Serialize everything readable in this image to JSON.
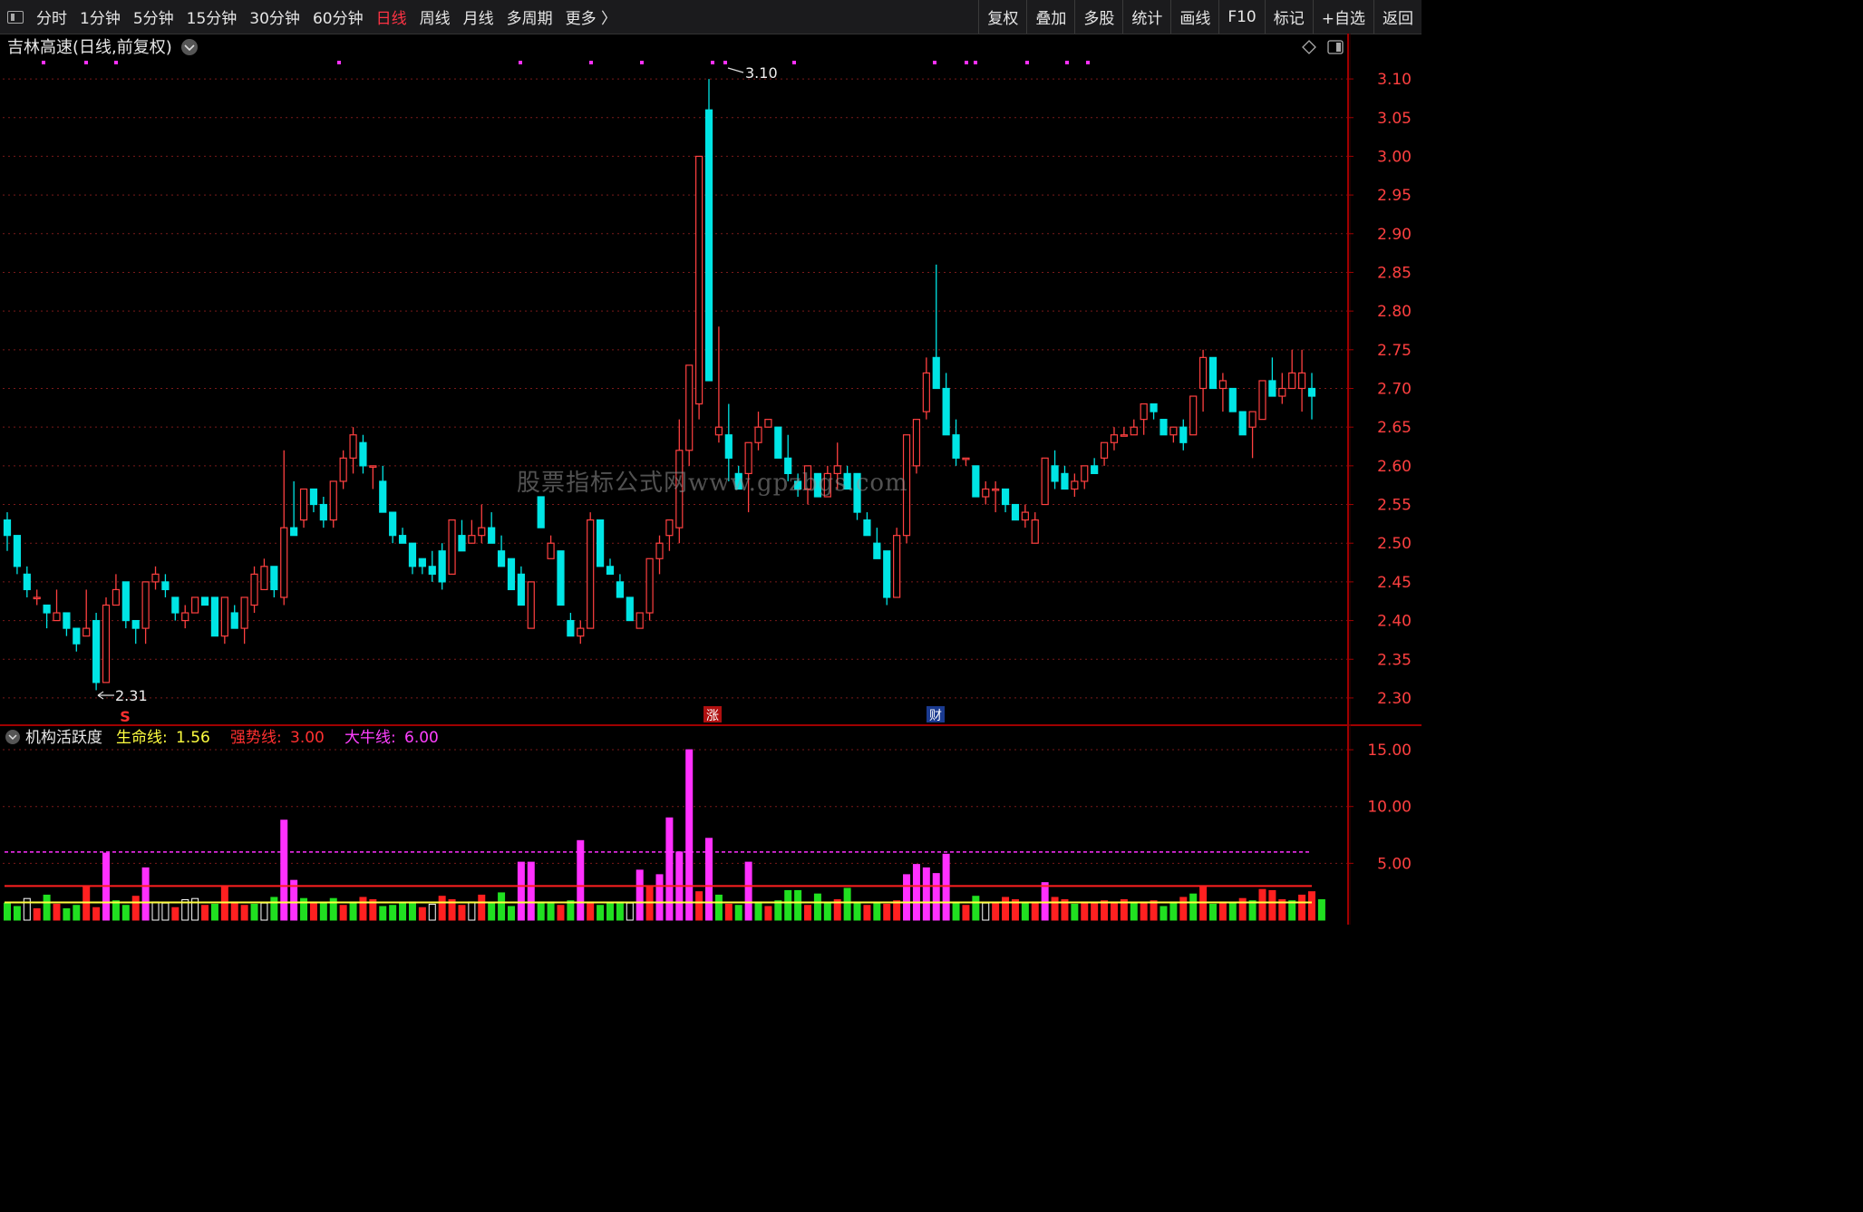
{
  "toolbar": {
    "periods": [
      "分时",
      "1分钟",
      "5分钟",
      "15分钟",
      "30分钟",
      "60分钟",
      "日线",
      "周线",
      "月线",
      "多周期",
      "更多 〉"
    ],
    "active_period": "日线",
    "right_buttons": [
      "复权",
      "叠加",
      "多股",
      "统计",
      "画线",
      "F10",
      "标记",
      "+自选",
      "返回"
    ]
  },
  "main_chart": {
    "title": "吉林高速(日线,前复权)",
    "high_label": "3.10",
    "low_label": "2.31",
    "y_ticks": [
      "3.10",
      "3.05",
      "3.00",
      "2.95",
      "2.90",
      "2.85",
      "2.80",
      "2.75",
      "2.70",
      "2.65",
      "2.60",
      "2.55",
      "2.50",
      "2.45",
      "2.40",
      "2.35",
      "2.30"
    ],
    "markers": {
      "s": "S",
      "zhang": "涨",
      "cai": "财"
    }
  },
  "indicator": {
    "name": "机构活跃度",
    "lines": [
      {
        "label": "生命线:",
        "value": "1.56",
        "color": "#ffff40"
      },
      {
        "label": "强势线:",
        "value": "3.00",
        "color": "#ff3030"
      },
      {
        "label": "大牛线:",
        "value": "6.00",
        "color": "#ff40ff"
      }
    ],
    "y_ticks": [
      "15.00",
      "10.00",
      "5.00"
    ]
  },
  "watermark": "股票指标公式网www.gpzbgs.com",
  "colors": {
    "up": "#ff4040",
    "down": "#00e5e5",
    "grid": "#7a1a1a",
    "axis": "#a00000",
    "magenta": "#ff30ff",
    "green": "#20e020"
  },
  "chart_data": {
    "type": "candlestick",
    "price_ylim": [
      2.28,
      3.12
    ],
    "indicator_ylim": [
      0,
      17
    ],
    "candles": [
      [
        2.53,
        2.54,
        2.49,
        2.51
      ],
      [
        2.51,
        2.51,
        2.46,
        2.47
      ],
      [
        2.46,
        2.47,
        2.43,
        2.44
      ],
      [
        2.43,
        2.44,
        2.42,
        2.43
      ],
      [
        2.42,
        2.42,
        2.39,
        2.41
      ],
      [
        2.4,
        2.44,
        2.4,
        2.41
      ],
      [
        2.41,
        2.41,
        2.38,
        2.39
      ],
      [
        2.39,
        2.39,
        2.36,
        2.37
      ],
      [
        2.38,
        2.44,
        2.38,
        2.39
      ],
      [
        2.4,
        2.41,
        2.31,
        2.32
      ],
      [
        2.32,
        2.43,
        2.32,
        2.42
      ],
      [
        2.42,
        2.46,
        2.42,
        2.44
      ],
      [
        2.45,
        2.45,
        2.39,
        2.4
      ],
      [
        2.4,
        2.4,
        2.37,
        2.39
      ],
      [
        2.39,
        2.45,
        2.37,
        2.45
      ],
      [
        2.45,
        2.47,
        2.44,
        2.46
      ],
      [
        2.45,
        2.46,
        2.43,
        2.44
      ],
      [
        2.43,
        2.43,
        2.4,
        2.41
      ],
      [
        2.4,
        2.42,
        2.39,
        2.41
      ],
      [
        2.41,
        2.43,
        2.41,
        2.43
      ],
      [
        2.43,
        2.43,
        2.42,
        2.42
      ],
      [
        2.43,
        2.43,
        2.38,
        2.38
      ],
      [
        2.38,
        2.43,
        2.37,
        2.43
      ],
      [
        2.41,
        2.42,
        2.39,
        2.39
      ],
      [
        2.39,
        2.43,
        2.37,
        2.43
      ],
      [
        2.42,
        2.47,
        2.41,
        2.46
      ],
      [
        2.44,
        2.48,
        2.44,
        2.47
      ],
      [
        2.47,
        2.47,
        2.43,
        2.44
      ],
      [
        2.43,
        2.62,
        2.42,
        2.52
      ],
      [
        2.52,
        2.58,
        2.52,
        2.51
      ],
      [
        2.53,
        2.57,
        2.52,
        2.57
      ],
      [
        2.57,
        2.57,
        2.54,
        2.55
      ],
      [
        2.55,
        2.56,
        2.52,
        2.53
      ],
      [
        2.53,
        2.58,
        2.52,
        2.58
      ],
      [
        2.58,
        2.62,
        2.57,
        2.61
      ],
      [
        2.61,
        2.65,
        2.59,
        2.64
      ],
      [
        2.63,
        2.64,
        2.59,
        2.6
      ],
      [
        2.6,
        2.6,
        2.57,
        2.6
      ],
      [
        2.58,
        2.6,
        2.54,
        2.54
      ],
      [
        2.54,
        2.54,
        2.5,
        2.51
      ],
      [
        2.51,
        2.52,
        2.5,
        2.5
      ],
      [
        2.5,
        2.5,
        2.46,
        2.47
      ],
      [
        2.48,
        2.48,
        2.46,
        2.47
      ],
      [
        2.47,
        2.49,
        2.45,
        2.46
      ],
      [
        2.49,
        2.5,
        2.44,
        2.45
      ],
      [
        2.46,
        2.53,
        2.46,
        2.53
      ],
      [
        2.51,
        2.53,
        2.49,
        2.49
      ],
      [
        2.5,
        2.53,
        2.5,
        2.51
      ],
      [
        2.51,
        2.55,
        2.5,
        2.52
      ],
      [
        2.52,
        2.54,
        2.5,
        2.5
      ],
      [
        2.49,
        2.51,
        2.48,
        2.47
      ],
      [
        2.48,
        2.48,
        2.44,
        2.44
      ],
      [
        2.46,
        2.47,
        2.42,
        2.42
      ],
      [
        2.39,
        2.45,
        2.39,
        2.45
      ],
      [
        2.56,
        2.56,
        2.52,
        2.52
      ],
      [
        2.48,
        2.51,
        2.48,
        2.5
      ],
      [
        2.49,
        2.49,
        2.42,
        2.42
      ],
      [
        2.4,
        2.41,
        2.38,
        2.38
      ],
      [
        2.38,
        2.4,
        2.37,
        2.39
      ],
      [
        2.39,
        2.54,
        2.39,
        2.53
      ],
      [
        2.53,
        2.53,
        2.47,
        2.47
      ],
      [
        2.47,
        2.48,
        2.46,
        2.46
      ],
      [
        2.45,
        2.46,
        2.43,
        2.43
      ],
      [
        2.43,
        2.43,
        2.4,
        2.4
      ],
      [
        2.39,
        2.4,
        2.39,
        2.41
      ],
      [
        2.41,
        2.48,
        2.4,
        2.48
      ],
      [
        2.48,
        2.51,
        2.46,
        2.5
      ],
      [
        2.51,
        2.53,
        2.49,
        2.53
      ],
      [
        2.52,
        2.66,
        2.5,
        2.62
      ],
      [
        2.62,
        2.7,
        2.6,
        2.73
      ],
      [
        2.68,
        3.0,
        2.66,
        3.0
      ],
      [
        3.06,
        3.1,
        2.74,
        2.71
      ],
      [
        2.64,
        2.78,
        2.63,
        2.65
      ],
      [
        2.64,
        2.68,
        2.58,
        2.61
      ],
      [
        2.59,
        2.6,
        2.57,
        2.57
      ],
      [
        2.59,
        2.63,
        2.54,
        2.63
      ],
      [
        2.63,
        2.67,
        2.62,
        2.65
      ],
      [
        2.65,
        2.66,
        2.65,
        2.66
      ],
      [
        2.65,
        2.65,
        2.61,
        2.61
      ],
      [
        2.61,
        2.64,
        2.58,
        2.59
      ],
      [
        2.58,
        2.59,
        2.56,
        2.57
      ],
      [
        2.57,
        2.6,
        2.55,
        2.6
      ],
      [
        2.59,
        2.59,
        2.56,
        2.56
      ],
      [
        2.56,
        2.6,
        2.56,
        2.59
      ],
      [
        2.59,
        2.63,
        2.57,
        2.6
      ],
      [
        2.59,
        2.6,
        2.57,
        2.57
      ],
      [
        2.59,
        2.59,
        2.53,
        2.54
      ],
      [
        2.53,
        2.54,
        2.51,
        2.51
      ],
      [
        2.5,
        2.52,
        2.48,
        2.48
      ],
      [
        2.49,
        2.49,
        2.42,
        2.43
      ],
      [
        2.43,
        2.52,
        2.43,
        2.51
      ],
      [
        2.51,
        2.64,
        2.5,
        2.64
      ],
      [
        2.6,
        2.66,
        2.59,
        2.66
      ],
      [
        2.67,
        2.74,
        2.66,
        2.72
      ],
      [
        2.74,
        2.86,
        2.7,
        2.7
      ],
      [
        2.7,
        2.72,
        2.64,
        2.64
      ],
      [
        2.64,
        2.66,
        2.6,
        2.61
      ],
      [
        2.61,
        2.61,
        2.6,
        2.61
      ],
      [
        2.6,
        2.6,
        2.56,
        2.56
      ],
      [
        2.56,
        2.58,
        2.55,
        2.57
      ],
      [
        2.57,
        2.58,
        2.54,
        2.57
      ],
      [
        2.57,
        2.57,
        2.54,
        2.55
      ],
      [
        2.55,
        2.55,
        2.53,
        2.53
      ],
      [
        2.53,
        2.55,
        2.52,
        2.54
      ],
      [
        2.5,
        2.54,
        2.5,
        2.53
      ],
      [
        2.55,
        2.61,
        2.55,
        2.61
      ],
      [
        2.6,
        2.62,
        2.57,
        2.58
      ],
      [
        2.59,
        2.6,
        2.57,
        2.57
      ],
      [
        2.57,
        2.59,
        2.56,
        2.58
      ],
      [
        2.58,
        2.6,
        2.57,
        2.6
      ],
      [
        2.6,
        2.61,
        2.59,
        2.59
      ],
      [
        2.61,
        2.63,
        2.6,
        2.63
      ],
      [
        2.63,
        2.65,
        2.62,
        2.64
      ],
      [
        2.64,
        2.65,
        2.64,
        2.64
      ],
      [
        2.64,
        2.66,
        2.64,
        2.65
      ],
      [
        2.66,
        2.68,
        2.64,
        2.68
      ],
      [
        2.68,
        2.68,
        2.66,
        2.67
      ],
      [
        2.66,
        2.66,
        2.64,
        2.64
      ],
      [
        2.64,
        2.65,
        2.63,
        2.65
      ],
      [
        2.65,
        2.66,
        2.62,
        2.63
      ],
      [
        2.64,
        2.69,
        2.64,
        2.69
      ],
      [
        2.7,
        2.75,
        2.67,
        2.74
      ],
      [
        2.74,
        2.74,
        2.7,
        2.7
      ],
      [
        2.7,
        2.72,
        2.67,
        2.71
      ],
      [
        2.7,
        2.7,
        2.67,
        2.67
      ],
      [
        2.67,
        2.67,
        2.64,
        2.64
      ],
      [
        2.65,
        2.67,
        2.61,
        2.67
      ],
      [
        2.66,
        2.71,
        2.66,
        2.71
      ],
      [
        2.71,
        2.74,
        2.69,
        2.69
      ],
      [
        2.69,
        2.72,
        2.68,
        2.7
      ],
      [
        2.7,
        2.75,
        2.7,
        2.72
      ],
      [
        2.7,
        2.75,
        2.67,
        2.72
      ],
      [
        2.7,
        2.72,
        2.66,
        2.69
      ]
    ],
    "indicator_bars": [
      [
        1.5,
        "g"
      ],
      [
        1.2,
        "g"
      ],
      [
        1.9,
        "w"
      ],
      [
        1.0,
        "r"
      ],
      [
        2.2,
        "g"
      ],
      [
        1.4,
        "r"
      ],
      [
        1.0,
        "g"
      ],
      [
        1.3,
        "g"
      ],
      [
        3.0,
        "r"
      ],
      [
        1.1,
        "r"
      ],
      [
        5.9,
        "m"
      ],
      [
        1.7,
        "g"
      ],
      [
        1.3,
        "g"
      ],
      [
        2.1,
        "r"
      ],
      [
        4.6,
        "m"
      ],
      [
        1.6,
        "w"
      ],
      [
        1.5,
        "w"
      ],
      [
        1.1,
        "r"
      ],
      [
        1.8,
        "w"
      ],
      [
        1.9,
        "w"
      ],
      [
        1.3,
        "r"
      ],
      [
        1.4,
        "g"
      ],
      [
        3.0,
        "r"
      ],
      [
        1.6,
        "r"
      ],
      [
        1.3,
        "r"
      ],
      [
        1.4,
        "g"
      ],
      [
        1.5,
        "w"
      ],
      [
        2.0,
        "g"
      ],
      [
        8.8,
        "m"
      ],
      [
        3.5,
        "m"
      ],
      [
        1.9,
        "g"
      ],
      [
        1.6,
        "r"
      ],
      [
        1.5,
        "g"
      ],
      [
        1.9,
        "g"
      ],
      [
        1.3,
        "r"
      ],
      [
        1.6,
        "g"
      ],
      [
        2.0,
        "r"
      ],
      [
        1.8,
        "r"
      ],
      [
        1.2,
        "g"
      ],
      [
        1.3,
        "g"
      ],
      [
        1.5,
        "g"
      ],
      [
        1.6,
        "g"
      ],
      [
        1.1,
        "r"
      ],
      [
        1.4,
        "w"
      ],
      [
        2.1,
        "r"
      ],
      [
        1.8,
        "r"
      ],
      [
        1.3,
        "r"
      ],
      [
        1.6,
        "w"
      ],
      [
        2.2,
        "r"
      ],
      [
        1.5,
        "g"
      ],
      [
        2.4,
        "g"
      ],
      [
        1.2,
        "g"
      ],
      [
        5.1,
        "m"
      ],
      [
        5.1,
        "m"
      ],
      [
        1.6,
        "g"
      ],
      [
        1.6,
        "g"
      ],
      [
        1.3,
        "r"
      ],
      [
        1.7,
        "g"
      ],
      [
        7.0,
        "m"
      ],
      [
        1.6,
        "r"
      ],
      [
        1.3,
        "g"
      ],
      [
        1.5,
        "g"
      ],
      [
        1.6,
        "g"
      ],
      [
        1.5,
        "w"
      ],
      [
        4.4,
        "m"
      ],
      [
        3.0,
        "r"
      ],
      [
        4.0,
        "m"
      ],
      [
        9.0,
        "m"
      ],
      [
        6.0,
        "m"
      ],
      [
        15.0,
        "m"
      ],
      [
        2.5,
        "r"
      ],
      [
        7.2,
        "m"
      ],
      [
        2.2,
        "g"
      ],
      [
        1.4,
        "r"
      ],
      [
        1.3,
        "g"
      ],
      [
        5.1,
        "m"
      ],
      [
        1.6,
        "g"
      ],
      [
        1.2,
        "r"
      ],
      [
        1.7,
        "g"
      ],
      [
        2.6,
        "g"
      ],
      [
        2.6,
        "g"
      ],
      [
        1.3,
        "r"
      ],
      [
        2.3,
        "g"
      ],
      [
        1.5,
        "g"
      ],
      [
        1.8,
        "r"
      ],
      [
        2.8,
        "g"
      ],
      [
        1.6,
        "g"
      ],
      [
        1.3,
        "r"
      ],
      [
        1.5,
        "g"
      ],
      [
        1.4,
        "r"
      ],
      [
        1.7,
        "r"
      ],
      [
        4.0,
        "m"
      ],
      [
        4.9,
        "m"
      ],
      [
        4.6,
        "m"
      ],
      [
        4.1,
        "m"
      ],
      [
        5.8,
        "m"
      ],
      [
        1.5,
        "g"
      ],
      [
        1.3,
        "r"
      ],
      [
        2.1,
        "g"
      ],
      [
        1.5,
        "w"
      ],
      [
        1.5,
        "r"
      ],
      [
        2.0,
        "r"
      ],
      [
        1.8,
        "r"
      ],
      [
        1.5,
        "g"
      ],
      [
        1.6,
        "r"
      ],
      [
        3.3,
        "m"
      ],
      [
        2.0,
        "r"
      ],
      [
        1.8,
        "r"
      ],
      [
        1.4,
        "g"
      ],
      [
        1.6,
        "r"
      ],
      [
        1.5,
        "r"
      ],
      [
        1.7,
        "r"
      ],
      [
        1.6,
        "r"
      ],
      [
        1.8,
        "r"
      ],
      [
        1.5,
        "g"
      ],
      [
        1.6,
        "r"
      ],
      [
        1.7,
        "r"
      ],
      [
        1.2,
        "g"
      ],
      [
        1.6,
        "g"
      ],
      [
        2.0,
        "r"
      ],
      [
        2.3,
        "g"
      ],
      [
        3.0,
        "r"
      ],
      [
        1.4,
        "g"
      ],
      [
        1.6,
        "r"
      ],
      [
        1.5,
        "g"
      ],
      [
        1.9,
        "r"
      ],
      [
        1.7,
        "g"
      ],
      [
        2.7,
        "r"
      ],
      [
        2.6,
        "r"
      ],
      [
        1.8,
        "r"
      ],
      [
        1.7,
        "g"
      ],
      [
        2.2,
        "r"
      ],
      [
        2.5,
        "r"
      ],
      [
        1.8,
        "g"
      ]
    ],
    "lines": {
      "生命线": 1.56,
      "强势线": 3.0,
      "大牛线": 6.0
    }
  }
}
